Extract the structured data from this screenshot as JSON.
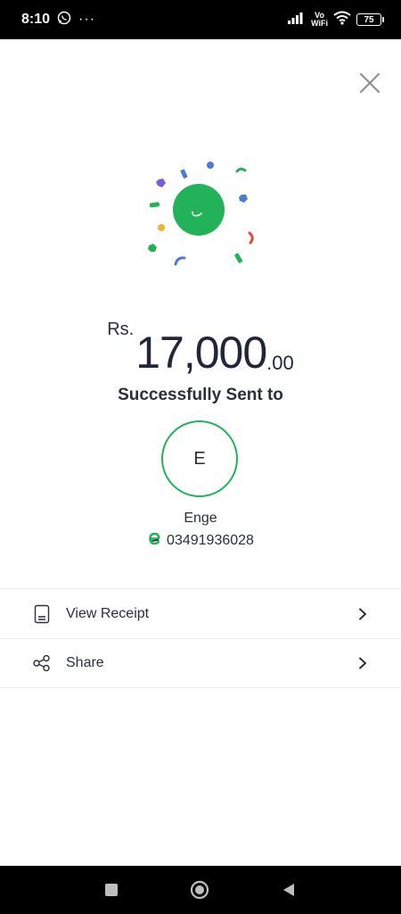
{
  "status_bar": {
    "time": "8:10",
    "network_label": "Vo\nWiFi",
    "battery": "75"
  },
  "amount": {
    "currency": "Rs.",
    "value": "17,000",
    "decimals": ".00"
  },
  "success_text": "Successfully Sent to",
  "recipient": {
    "initial": "E",
    "name": "Enge",
    "phone": "03491936028"
  },
  "actions": {
    "view_receipt": "View Receipt",
    "share": "Share"
  },
  "colors": {
    "accent_green": "#22b35a",
    "confetti": [
      "#7a5cd6",
      "#4a7cd6",
      "#22b35a",
      "#e0493f",
      "#f2b233"
    ]
  }
}
